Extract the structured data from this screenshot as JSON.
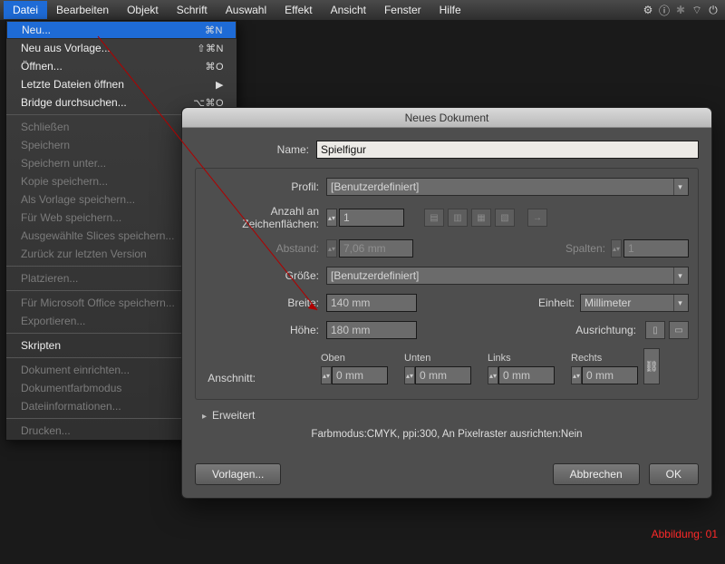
{
  "menubar": {
    "items": [
      "Datei",
      "Bearbeiten",
      "Objekt",
      "Schrift",
      "Auswahl",
      "Effekt",
      "Ansicht",
      "Fenster",
      "Hilfe"
    ],
    "activeIndex": 0,
    "systray": [
      "⚙",
      "ⓘ",
      "✶",
      "🔊",
      "⏻"
    ]
  },
  "dropdown": {
    "items": [
      {
        "label": "Neu...",
        "shortcut": "⌘N",
        "selected": true
      },
      {
        "label": "Neu aus Vorlage...",
        "shortcut": "⇧⌘N"
      },
      {
        "label": "Öffnen...",
        "shortcut": "⌘O"
      },
      {
        "label": "Letzte Dateien öffnen",
        "shortcut": "▶"
      },
      {
        "label": "Bridge durchsuchen...",
        "shortcut": "⌥⌘O"
      },
      {
        "sep": true
      },
      {
        "label": "Schließen",
        "disabled": true
      },
      {
        "label": "Speichern",
        "disabled": true
      },
      {
        "label": "Speichern unter...",
        "disabled": true
      },
      {
        "label": "Kopie speichern...",
        "disabled": true
      },
      {
        "label": "Als Vorlage speichern...",
        "disabled": true
      },
      {
        "label": "Für Web speichern...",
        "disabled": true
      },
      {
        "label": "Ausgewählte Slices speichern...",
        "disabled": true
      },
      {
        "label": "Zurück zur letzten Version",
        "disabled": true
      },
      {
        "sep": true
      },
      {
        "label": "Platzieren...",
        "disabled": true
      },
      {
        "sep": true
      },
      {
        "label": "Für Microsoft Office speichern...",
        "disabled": true
      },
      {
        "label": "Exportieren...",
        "disabled": true
      },
      {
        "sep": true
      },
      {
        "label": "Skripten"
      },
      {
        "sep": true
      },
      {
        "label": "Dokument einrichten...",
        "disabled": true
      },
      {
        "label": "Dokumentfarbmodus",
        "disabled": true
      },
      {
        "label": "Dateiinformationen...",
        "disabled": true
      },
      {
        "sep": true
      },
      {
        "label": "Drucken...",
        "disabled": true
      }
    ]
  },
  "dialog": {
    "title": "Neues Dokument",
    "labels": {
      "name": "Name:",
      "profile": "Profil:",
      "artboards": "Anzahl an Zeichenflächen:",
      "spacing": "Abstand:",
      "columns": "Spalten:",
      "size": "Größe:",
      "width": "Breite:",
      "height": "Höhe:",
      "unit": "Einheit:",
      "orientation": "Ausrichtung:",
      "bleed": "Anschnitt:",
      "top": "Oben",
      "bottom": "Unten",
      "left": "Links",
      "right": "Rechts",
      "advanced": "Erweitert"
    },
    "values": {
      "name": "Spielfigur",
      "profile": "[Benutzerdefiniert]",
      "artboards": "1",
      "spacing": "7,06 mm",
      "columns": "1",
      "size": "[Benutzerdefiniert]",
      "width": "140 mm",
      "height": "180 mm",
      "unit": "Millimeter",
      "bleed_top": "0 mm",
      "bleed_bottom": "0 mm",
      "bleed_left": "0 mm",
      "bleed_right": "0 mm",
      "modeinfo": "Farbmodus:CMYK, ppi:300, An Pixelraster ausrichten:Nein"
    },
    "buttons": {
      "templates": "Vorlagen...",
      "cancel": "Abbrechen",
      "ok": "OK"
    }
  },
  "caption": "Abbildung: 01"
}
